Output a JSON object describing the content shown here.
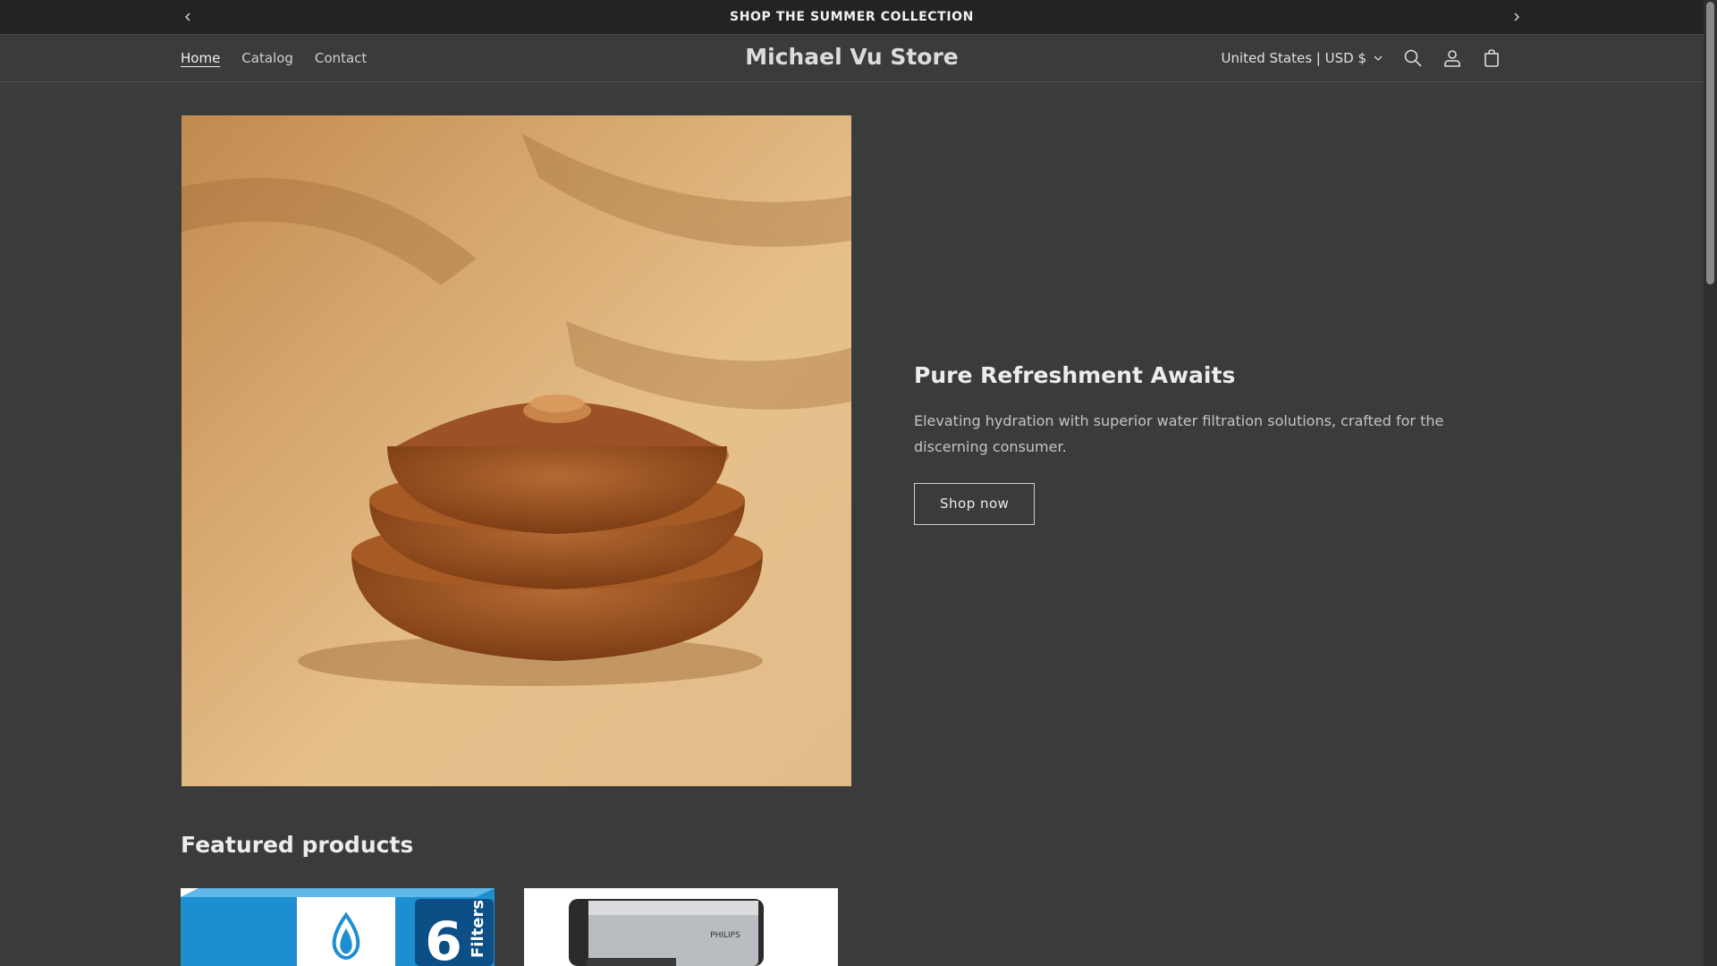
{
  "announcement": {
    "text": "SHOP THE SUMMER COLLECTION",
    "prev_icon": "chevron-left-icon",
    "next_icon": "chevron-right-icon"
  },
  "header": {
    "nav": [
      {
        "label": "Home",
        "active": true
      },
      {
        "label": "Catalog",
        "active": false
      },
      {
        "label": "Contact",
        "active": false
      }
    ],
    "store_name": "Michael Vu Store",
    "country_selector": "United States | USD $",
    "icons": [
      "search-icon",
      "account-icon",
      "cart-icon"
    ]
  },
  "hero": {
    "image_alt": "stacked-cookware-pots-image",
    "title": "Pure Refreshment Awaits",
    "description": "Elevating hydration with superior water filtration solutions, crafted for the discerning consumer.",
    "button_label": "Shop now"
  },
  "featured": {
    "title": "Featured products",
    "products": [
      {
        "image": "water-filter-6-pack-image",
        "box_text": "6",
        "box_subtext": "Filters"
      },
      {
        "image": "philips-coffee-maker-image",
        "brand_text": "PHILIPS"
      }
    ]
  },
  "colors": {
    "background": "#3b3b3b",
    "announcement_bg": "#232323",
    "text": "#e8e8e8"
  }
}
